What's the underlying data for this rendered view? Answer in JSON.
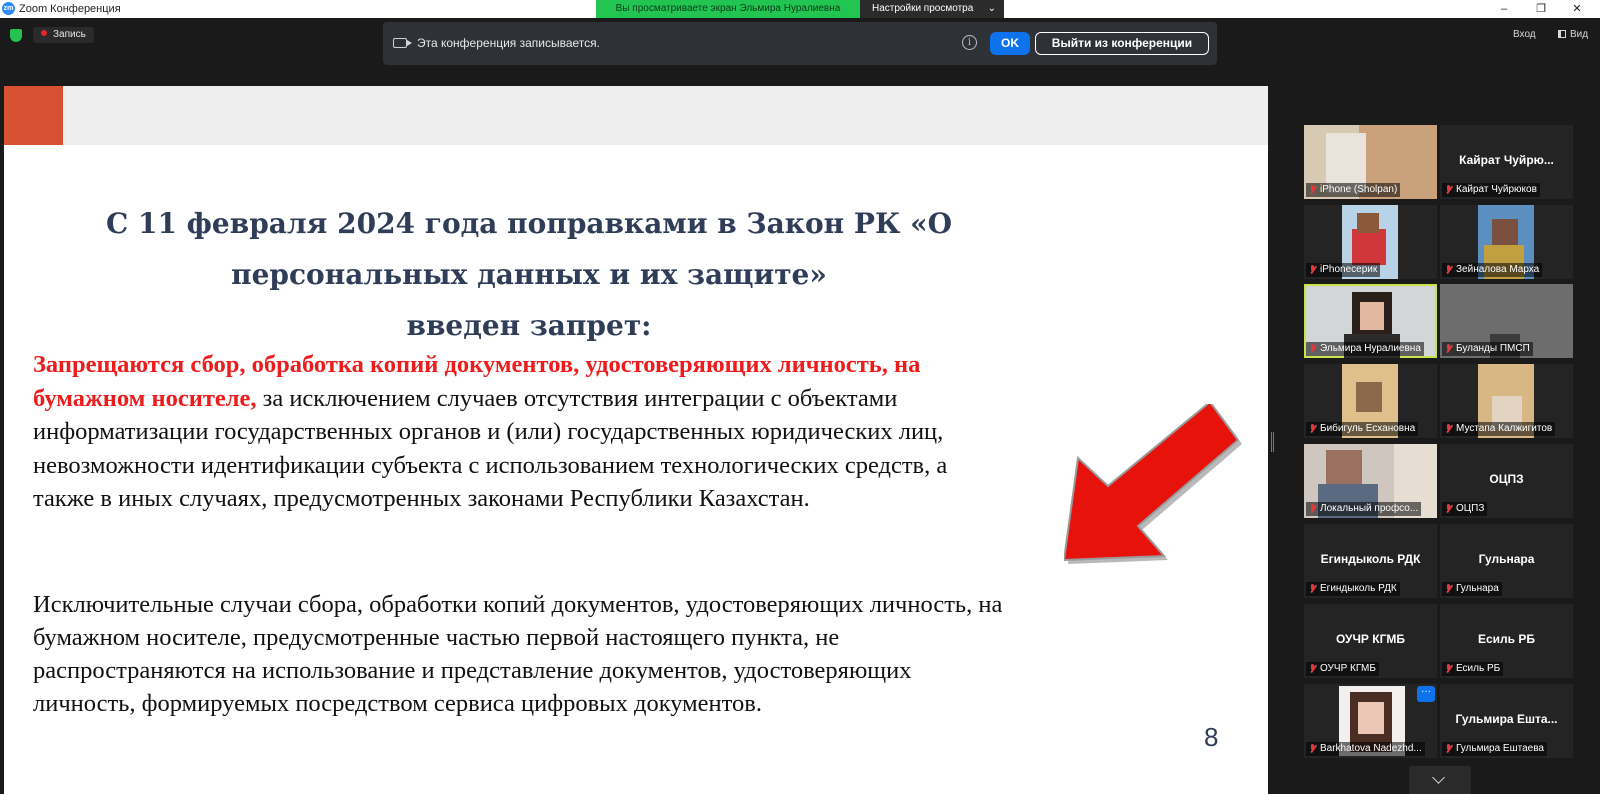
{
  "window": {
    "app_logo": "zm",
    "title": "Zoom Конференция",
    "share_banner": "Вы просматриваете экран Эльмира Нуралиевна",
    "view_options": "Настройки просмотра",
    "minimize": "–",
    "maximize": "❐",
    "close": "✕"
  },
  "toolbar": {
    "recording_label": "Запись",
    "notice_text": "Эта конференция записывается.",
    "info_glyph": "i",
    "ok_label": "OK",
    "leave_label": "Выйти из конференции",
    "login_label": "Вход",
    "view_label": "Вид"
  },
  "slide": {
    "title_lines": [
      "С 11 февраля 2024 года поправками в Закон РК «О",
      "персональных данных и их защите»",
      "введен запрет:"
    ],
    "para1_red": "Запрещаются сбор, обработка копий документов, удостоверяющих личность, на бумажном носителе,",
    "para1_rest": " за исключением случаев отсутствия интеграции с объектами информатизации государственных органов и (или) государственных юридических лиц, невозможности идентификации субъекта с использованием технологических средств, а также в иных случаях, предусмотренных законами Республики Казахстан.",
    "para2": "Исключительные случаи сбора, обработки копий документов, удостоверяющих личность, на бумажном носителе, предусмотренные частью первой настоящего пункта, не распространяются на использование и представление документов, удостоверяющих личность, формируемых посредством сервиса цифровых документов.",
    "page_number": "8",
    "accent_color": "#d85132",
    "title_color": "#2f3d58",
    "highlight_color": "#ee1c1c"
  },
  "participants": [
    {
      "label": "iPhone (Sholpan)",
      "center_name": "",
      "has_video": true
    },
    {
      "label": "Кайрат  Чуйрюков",
      "center_name": "Кайрат  Чуйрю...",
      "has_video": false
    },
    {
      "label": "iPhoneсерик",
      "center_name": "",
      "has_video": true
    },
    {
      "label": "Зейналова Марха",
      "center_name": "",
      "has_video": true
    },
    {
      "label": "Эльмира Нуралиевна",
      "center_name": "",
      "has_video": true,
      "active_speaker": true
    },
    {
      "label": "Буланды ПМСП",
      "center_name": "",
      "has_video": true
    },
    {
      "label": "Бибигуль Есхановна",
      "center_name": "",
      "has_video": true
    },
    {
      "label": "Мустапа Калжигитов",
      "center_name": "",
      "has_video": true
    },
    {
      "label": "Локальный профсо...",
      "center_name": "",
      "has_video": true
    },
    {
      "label": "ОЦПЗ",
      "center_name": "ОЦПЗ",
      "has_video": false
    },
    {
      "label": "Егиндыколь РДК",
      "center_name": "Егиндыколь РДК",
      "has_video": false
    },
    {
      "label": "Гульнара",
      "center_name": "Гульнара",
      "has_video": false
    },
    {
      "label": "ОУЧР КГМБ",
      "center_name": "ОУЧР КГМБ",
      "has_video": false
    },
    {
      "label": "Есиль РБ",
      "center_name": "Есиль РБ",
      "has_video": false
    },
    {
      "label": "Barkhatova Nadezhd...",
      "center_name": "",
      "has_video": true,
      "more_menu": "···"
    },
    {
      "label": "Гульмира Ештаева",
      "center_name": "Гульмира  Ешта...",
      "has_video": false
    }
  ]
}
